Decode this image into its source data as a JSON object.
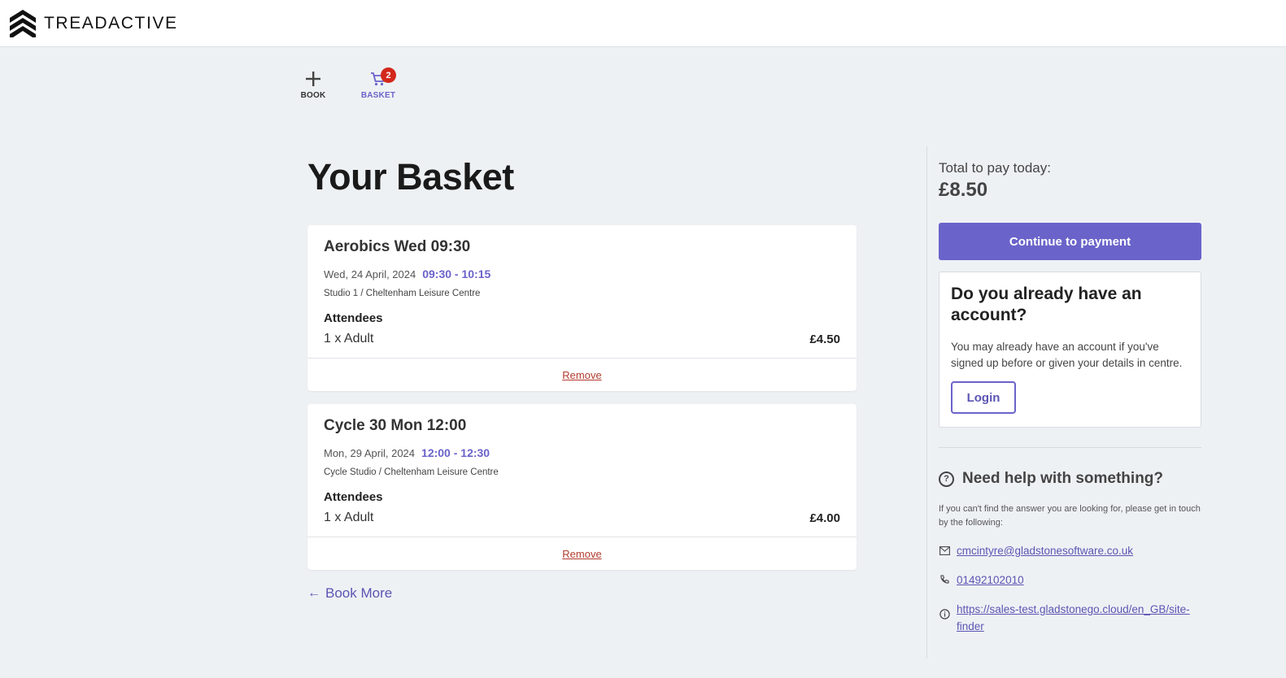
{
  "brand": {
    "name": "TREADACTIVE",
    "logo_icon": "treadactive-chevrons-logo"
  },
  "nav": {
    "book_label": "BOOK",
    "basket_label": "BASKET",
    "basket_count": "2",
    "active": "basket"
  },
  "page": {
    "title": "Your Basket"
  },
  "basket": {
    "items": [
      {
        "title": "Aerobics Wed 09:30",
        "date": "Wed, 24 April, 2024",
        "time": "09:30 - 10:15",
        "location": "Studio 1 / Cheltenham Leisure Centre",
        "attendees_label": "Attendees",
        "quantity": "1 x Adult",
        "price": "£4.50",
        "remove_label": "Remove"
      },
      {
        "title": "Cycle 30 Mon 12:00",
        "date": "Mon, 29 April, 2024",
        "time": "12:00 - 12:30",
        "location": "Cycle Studio / Cheltenham Leisure Centre",
        "attendees_label": "Attendees",
        "quantity": "1 x Adult",
        "price": "£4.00",
        "remove_label": "Remove"
      }
    ],
    "book_more_label": "Book More"
  },
  "summary": {
    "total_label": "Total to pay today:",
    "total_value": "£8.50",
    "pay_button": "Continue to payment"
  },
  "account": {
    "title": "Do you already have an account?",
    "text": "You may already have an account if you've signed up before or given your details in centre.",
    "login_button": "Login"
  },
  "help": {
    "title": "Need help with something?",
    "text": "If you can't find the answer you are looking for, please get in touch by the following:",
    "email": "cmcintyre@gladstonesoftware.co.uk",
    "phone": "01492102010",
    "website": "https://sales-test.gladstonego.cloud/en_GB/site-finder"
  },
  "colors": {
    "accent": "#6a63c9",
    "badge": "#d3281c",
    "remove": "#b23b2e",
    "background": "#eef1f4"
  }
}
